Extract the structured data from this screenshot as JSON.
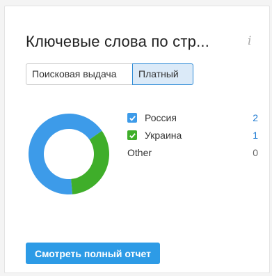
{
  "widget": {
    "title": "Ключевые слова по стр...",
    "info_icon_glyph": "i"
  },
  "tabs": [
    {
      "label": "Поисковая выдача",
      "active": false
    },
    {
      "label": "Платный",
      "active": true
    }
  ],
  "legend": [
    {
      "label": "Россия",
      "value": "2",
      "checked": true,
      "color": "#3d9be9"
    },
    {
      "label": "Украина",
      "value": "1",
      "checked": true,
      "color": "#3fae2a"
    },
    {
      "label": "Other",
      "value": "0",
      "checked": false,
      "color": "#cccccc"
    }
  ],
  "report_button": {
    "label": "Смотреть полный отчет"
  },
  "colors": {
    "accent": "#2d9be6",
    "link": "#1f7bd2",
    "russia": "#3d9be9",
    "ukraine": "#3fae2a"
  },
  "chart_data": {
    "type": "pie",
    "categories": [
      "Россия",
      "Украина",
      "Other"
    ],
    "values": [
      2,
      1,
      0
    ]
  }
}
